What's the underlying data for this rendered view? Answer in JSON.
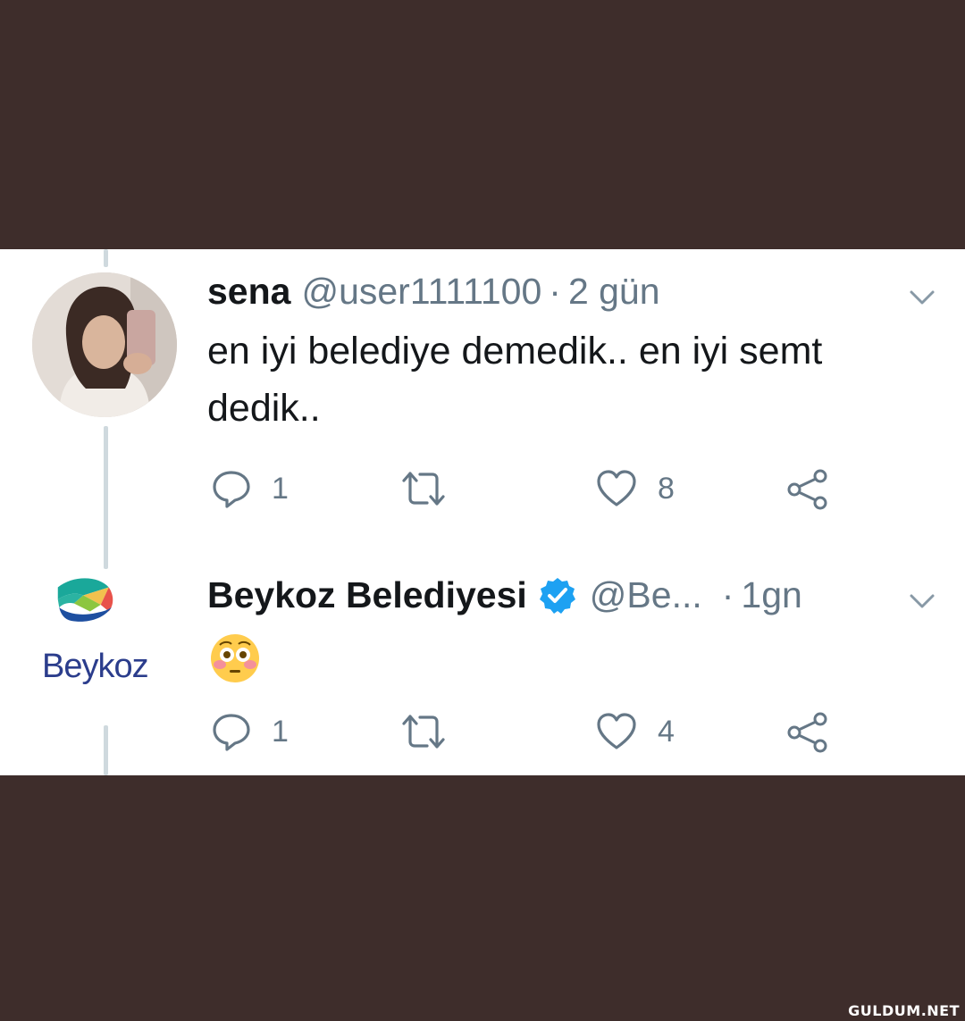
{
  "tweet1": {
    "name": "sena",
    "handle": "@user1111100",
    "separator": "·",
    "time": "2 gün",
    "text": "en iyi belediye demedik.. en iyi semt dedik..",
    "replies": "1",
    "likes": "8"
  },
  "tweet2": {
    "name": "Beykoz Belediyesi",
    "handle": "@Be...",
    "separator": "·",
    "time": "1gn",
    "emoji": "flushed-face-emoji",
    "replies": "1",
    "likes": "4",
    "avatar_text": "Beykoz"
  },
  "watermark": "GULDUM.NET",
  "colors": {
    "background": "#3e2d2b",
    "card": "#ffffff",
    "text": "#14171a",
    "muted": "#657786",
    "verified": "#1da1f2",
    "thread_line": "#cfd9de"
  }
}
